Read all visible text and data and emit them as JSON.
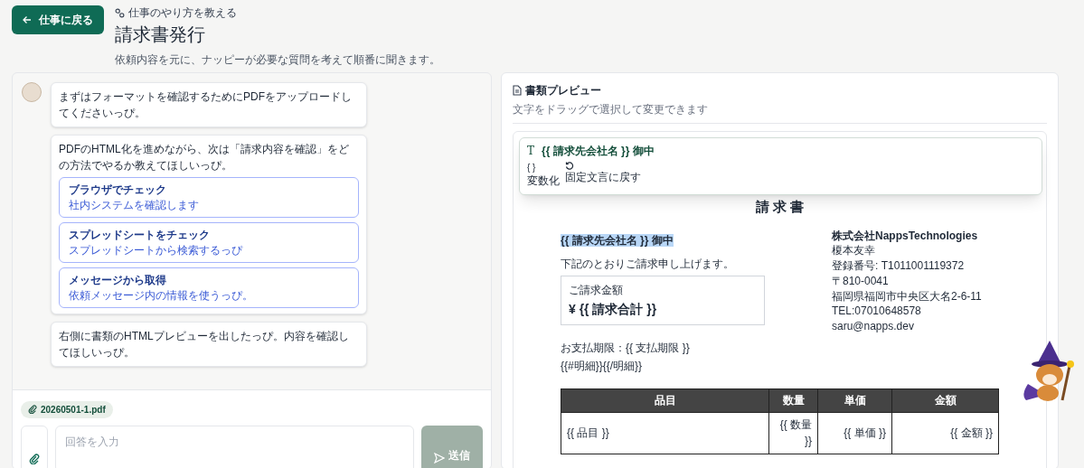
{
  "header": {
    "back_button": "仕事に戻る",
    "breadcrumb": "仕事のやり方を教える",
    "title": "請求書発行",
    "description": "依頼内容を元に、ナッピーが必要な質問を考えて順番に聞きます。"
  },
  "chat": {
    "messages": [
      {
        "kind": "text",
        "text": "まずはフォーマットを確認するためにPDFをアップロードしてくださいっぴ。"
      },
      {
        "kind": "choices",
        "text": "PDFのHTML化を進めながら、次は「請求内容を確認」をどの方法でやるか教えてほしいっぴ。",
        "options": [
          {
            "title": "ブラウザでチェック",
            "subtitle": "社内システムを確認します"
          },
          {
            "title": "スプレッドシートをチェック",
            "subtitle": "スプレッドシートから検索するっぴ"
          },
          {
            "title": "メッセージから取得",
            "subtitle": "依頼メッセージ内の情報を使うっぴ。"
          }
        ]
      },
      {
        "kind": "text",
        "text": "右側に書類のHTMLプレビューを出したっぴ。内容を確認してほしいっぴ。"
      }
    ],
    "attachment": "20260501-1.pdf",
    "input": {
      "placeholder": "回答を入力"
    },
    "send_button": "送信"
  },
  "preview": {
    "title": "書類プレビュー",
    "hint": "文字をドラッグで選択して変更できます",
    "popup": {
      "icon": "T",
      "selection": "{{ 請求先会社名 }} 御中",
      "actions": [
        {
          "kind": "glyph",
          "glyph": "{ }",
          "label": "変数化"
        },
        {
          "kind": "reset",
          "label": "固定文言に戻す"
        }
      ]
    },
    "document": {
      "title": "請 求 書",
      "recipient": {
        "text": "{{ 請求先会社名 }} 御中",
        "selected": true
      },
      "intro": "下記のとおりご請求申し上げます。",
      "amount_label": "ご請求金額",
      "amount": "¥ {{ 請求合計 }}",
      "due": "お支払期限：{{ 支払期限 }}",
      "loop": "{{#明細}}{{/明細}}",
      "issuer": [
        "株式会社NappsTechnologies",
        "榎本友幸",
        "登録番号: T1011001119372",
        "〒810-0041",
        "福岡県福岡市中央区大名2-6-11",
        "TEL:07010648578",
        "saru@napps.dev"
      ],
      "table": {
        "columns": [
          "品目",
          "数量",
          "単価",
          "金額"
        ],
        "rows": [
          [
            "{{ 品目 }}",
            "{{ 数量 }}",
            "{{ 単価 }}",
            "{{ 金額 }}"
          ]
        ]
      }
    }
  }
}
